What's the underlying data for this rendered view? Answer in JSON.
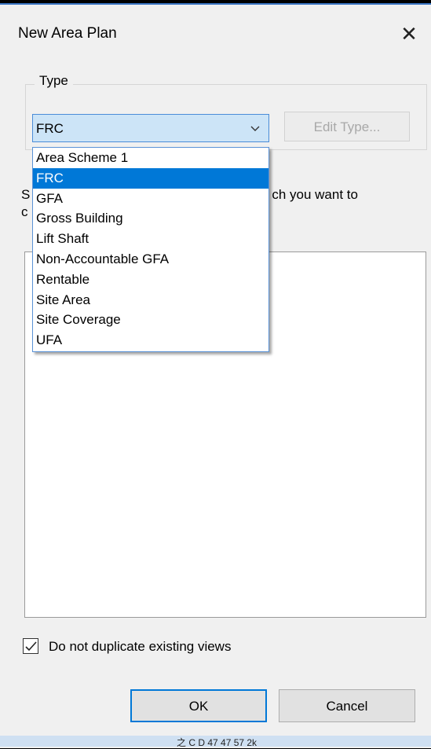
{
  "window": {
    "title": "New Area Plan",
    "close_icon": "close-icon"
  },
  "type_group": {
    "legend": "Type",
    "selected": "FRC",
    "edit_type_label": "Edit Type...",
    "options": [
      "Area Scheme 1",
      "FRC",
      "GFA",
      "Gross Building",
      "Lift Shaft",
      "Non-Accountable GFA",
      "Rentable",
      "Site Area",
      "Site Coverage",
      "UFA"
    ],
    "selected_index": 1
  },
  "description": {
    "left": "S",
    "right": "ch you want to",
    "line2_left": "c"
  },
  "checkbox": {
    "label": "Do not duplicate existing views",
    "checked": true
  },
  "buttons": {
    "ok": "OK",
    "cancel": "Cancel"
  },
  "bottom_text": "之 C D 47 47 57 2k",
  "colors": {
    "accent": "#0078d7",
    "combo_bg": "#cce4f7"
  }
}
